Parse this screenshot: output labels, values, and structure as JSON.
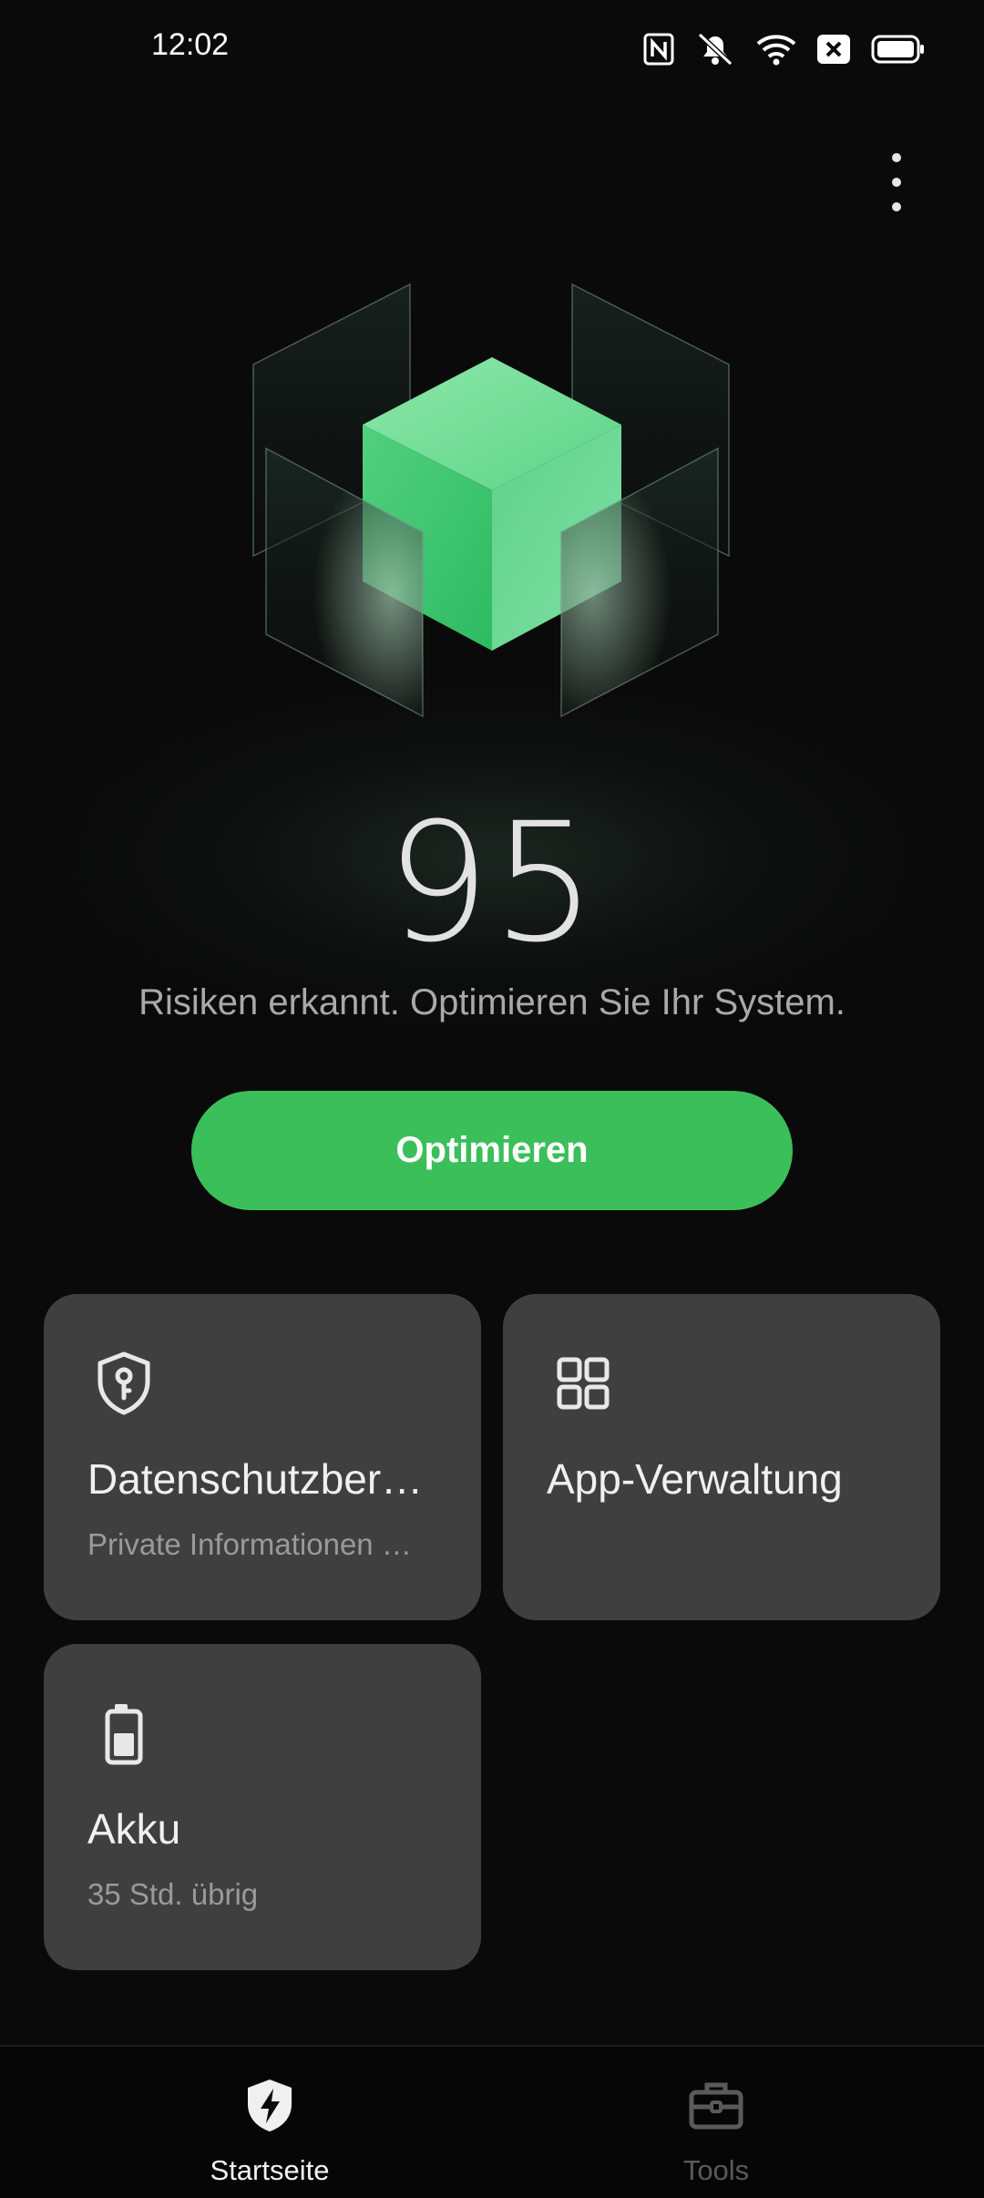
{
  "status_bar": {
    "time": "12:02",
    "icons": [
      "nfc-icon",
      "mute-icon",
      "wifi-icon",
      "sim-blocked-icon",
      "battery-icon"
    ]
  },
  "header": {
    "more_icon": "more-vertical-icon"
  },
  "hero": {
    "score": "95",
    "description": "Risiken erkannt. Optimieren Sie Ihr System.",
    "accent_color": "#3bbf5a"
  },
  "actions": {
    "optimize_label": "Optimieren"
  },
  "cards": [
    {
      "title": "Datenschutzber…",
      "subtitle": "Private Informationen …",
      "icon": "privacy-shield-key-icon"
    },
    {
      "title": "App-Verwaltung",
      "subtitle": "",
      "icon": "app-grid-icon"
    },
    {
      "title": "Akku",
      "subtitle": "35 Std. übrig",
      "icon": "battery-icon"
    }
  ],
  "bottom_nav": {
    "items": [
      {
        "label": "Startseite",
        "icon": "home-shield-bolt-icon",
        "active": true
      },
      {
        "label": "Tools",
        "icon": "toolbox-icon",
        "active": false
      }
    ]
  }
}
